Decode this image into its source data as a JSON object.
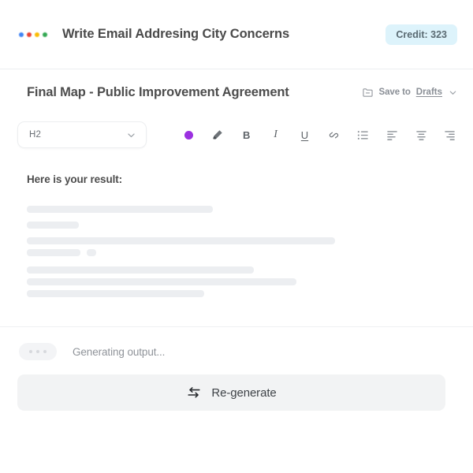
{
  "topbar": {
    "logo_icon": "four-color-dots-icon",
    "title": "Write Email Addresing City Concerns",
    "credit_label": "Credit: 323",
    "credit_bg": "#ddf3fb"
  },
  "doc_header": {
    "title": "Final Map - Public Improvement Agreement",
    "save": {
      "icon": "folder-minus-icon",
      "label_plain": "Save to ",
      "label_underline": "Drafts",
      "chevron_icon": "chevron-down-icon"
    }
  },
  "toolbar": {
    "heading_select": {
      "value": "H2",
      "chevron_icon": "chevron-down-icon"
    },
    "tools": [
      {
        "name": "text-color-swatch",
        "kind": "dot",
        "color": "#9b30e0",
        "label": ""
      },
      {
        "name": "highlighter-icon",
        "kind": "svg-highlighter",
        "label": ""
      },
      {
        "name": "bold-button",
        "kind": "glyph-bold",
        "label": "B"
      },
      {
        "name": "italic-button",
        "kind": "glyph-italic",
        "label": "I"
      },
      {
        "name": "underline-button",
        "kind": "glyph-underline",
        "label": "U"
      },
      {
        "name": "link-button",
        "kind": "svg-link",
        "label": ""
      },
      {
        "name": "bullet-list-button",
        "kind": "svg-bullet-list",
        "label": ""
      },
      {
        "name": "align-left-button",
        "kind": "svg-align-left",
        "label": ""
      },
      {
        "name": "align-center-button",
        "kind": "svg-align-center",
        "label": ""
      },
      {
        "name": "align-right-button",
        "kind": "svg-align-right",
        "label": ""
      }
    ]
  },
  "result": {
    "heading": "Here is your result:",
    "skeleton_rows": [
      {
        "segments": [
          236
        ]
      },
      {
        "segments": [
          66
        ]
      },
      {
        "segments": [
          391
        ]
      },
      {
        "segments": [
          68,
          12
        ]
      },
      {
        "segments": [
          288
        ]
      },
      {
        "segments": [
          342
        ]
      },
      {
        "segments": [
          225
        ]
      }
    ]
  },
  "status": {
    "typing_icon": "three-dots-typing-icon",
    "text": "Generating output..."
  },
  "regenerate": {
    "icon": "swap-arrows-icon",
    "label": "Re-generate",
    "bg": "#f2f3f4"
  }
}
